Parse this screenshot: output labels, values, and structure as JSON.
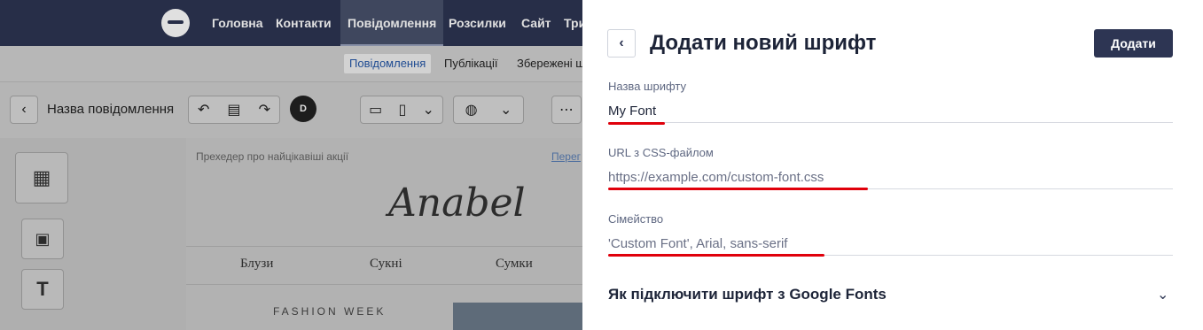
{
  "topnav": {
    "items": [
      "Головна",
      "Контакти",
      "Повідомлення",
      "Розсилки",
      "Сайт",
      "Три"
    ]
  },
  "subnav": {
    "tabs": [
      "Повідомлення",
      "Публікації",
      "Збережені ш"
    ]
  },
  "editor": {
    "message_name": "Назва повідомлення",
    "avatar_letter": "D",
    "preheader": "Прехедер про найцікавіші акції",
    "preheader_link": "Перег",
    "brand": "Anabel",
    "menu": [
      "Блузи",
      "Сукні",
      "Сумки"
    ],
    "fashion_week": "FASHION WEEK"
  },
  "drawer": {
    "title": "Додати новий шрифт",
    "add_label": "Додати",
    "fields": [
      {
        "label": "Назва шрифту",
        "value": "My Font"
      },
      {
        "label": "URL з CSS-файлом",
        "value": "https://example.com/custom-font.css"
      },
      {
        "label": "Сімейство",
        "value": "'Custom Font', Arial, sans-serif"
      }
    ],
    "accordion_title": "Як підключити шрифт з Google Fonts"
  },
  "colors": {
    "nav_bg": "#2d3553",
    "primary_button": "#2d3553",
    "highlight_underline": "#e0000b",
    "value_text": "#1d2438",
    "placeholder_text": "#6a7086"
  },
  "icons": [
    "back-icon",
    "undo-icon",
    "document-icon",
    "redo-icon",
    "desktop-icon",
    "mobile-icon",
    "chevron-down-icon",
    "globe-icon",
    "more-icon",
    "layout-icon",
    "image-icon",
    "text-icon",
    "drag-handle-icon"
  ]
}
